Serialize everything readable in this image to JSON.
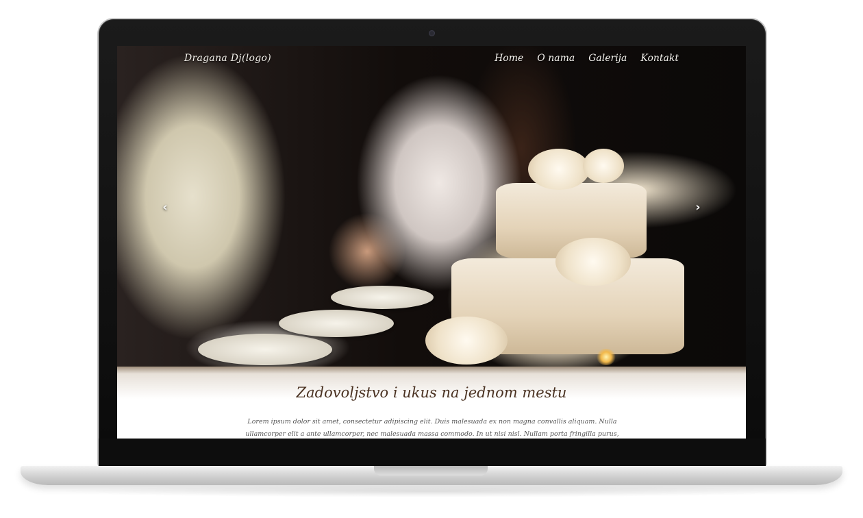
{
  "site": {
    "logo_text": "Dragana Dj(logo)",
    "nav": [
      "Home",
      "O nama",
      "Galerija",
      "Kontakt"
    ]
  },
  "hero": {
    "prev_arrow": "‹",
    "next_arrow": "›"
  },
  "content": {
    "headline": "Zadovoljstvo i ukus na jednom mestu",
    "paragraph": "Lorem ipsum dolor sit amet, consectetur adipiscing elit. Duis malesuada ex non magna convallis aliquam. Nulla ullamcorper elit a ante ullamcorper, nec malesuada massa commodo. In ut nisi nisl. Nullam porta fringilla purus, quis mollis enim tincidunt ut. Praesent vitae lacus ligula. Aliquam efficitur"
  },
  "colors": {
    "headline": "#4a3222",
    "nav_text": "#f5f3ee",
    "frame": "#111111"
  }
}
